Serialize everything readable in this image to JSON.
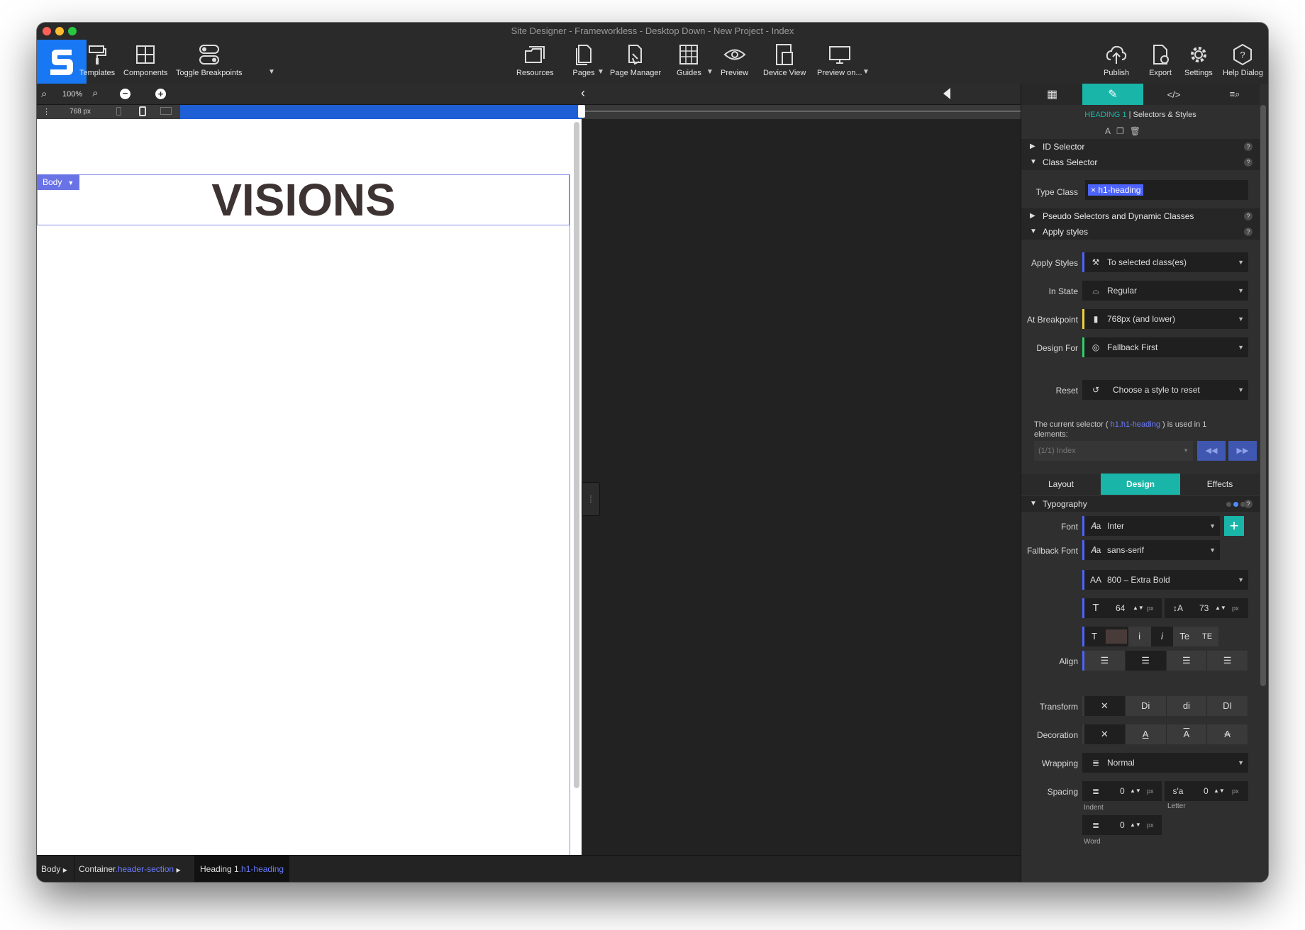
{
  "window": {
    "title": "Site Designer - Frameworkless - Desktop Down - New Project - Index"
  },
  "colors": {
    "accent_blue": "#1877f2",
    "teal": "#19b5a8",
    "selector_blue": "#6b7cff",
    "heading_text": "#3e3333",
    "swatch": "#4a3b3b"
  },
  "toolbar": {
    "left": [
      {
        "label": "Templates",
        "icon": "paint-roller-icon"
      },
      {
        "label": "Components",
        "icon": "components-grid-icon"
      },
      {
        "label": "Toggle Breakpoints",
        "icon": "toggle-icon"
      }
    ],
    "center": [
      {
        "label": "Resources",
        "icon": "folders-icon"
      },
      {
        "label": "Pages",
        "icon": "pages-icon"
      },
      {
        "label": "Page Manager",
        "icon": "page-manager-icon"
      },
      {
        "label": "Guides",
        "icon": "guides-grid-icon"
      },
      {
        "label": "Preview",
        "icon": "eye-icon"
      },
      {
        "label": "Device View",
        "icon": "devices-icon"
      },
      {
        "label": "Preview on...",
        "icon": "monitor-icon"
      }
    ],
    "right": [
      {
        "label": "Publish",
        "icon": "cloud-upload-icon"
      },
      {
        "label": "Export",
        "icon": "export-icon"
      },
      {
        "label": "Settings",
        "icon": "gear-icon"
      },
      {
        "label": "Help Dialog",
        "icon": "help-hexagon-icon"
      }
    ]
  },
  "zoom": {
    "level": "100%",
    "breakpoint": "768 px"
  },
  "canvas": {
    "body_tag": "Body",
    "heading": "VISIONS"
  },
  "statusbar": {
    "body": "Body",
    "container": "Container",
    "container_class": ".header-section",
    "heading": "Heading 1",
    "heading_class": ".h1-heading"
  },
  "panel": {
    "header_prefix": "HEADING 1",
    "header_suffix": "| Selectors & Styles",
    "id_selector": "ID Selector",
    "class_selector": "Class Selector",
    "type_class_label": "Type Class",
    "type_class_value": "h1-heading",
    "pseudo": "Pseudo Selectors and Dynamic Classes",
    "apply_styles_section": "Apply styles",
    "apply_styles_label": "Apply Styles",
    "apply_styles_value": "To selected class(es)",
    "in_state_label": "In State",
    "in_state_value": "Regular",
    "breakpoint_label": "At Breakpoint",
    "breakpoint_value": "768px (and lower)",
    "design_for_label": "Design For",
    "design_for_value": "Fallback First",
    "reset_label": "Reset",
    "reset_value": "Choose a style to reset",
    "info_prefix": "The current selector (",
    "info_selector": "h1.h1-heading",
    "info_mid": ") is used in",
    "info_count": "1",
    "info_suffix": "elements:",
    "page_select": "(1/1) Index",
    "tabs": {
      "layout": "Layout",
      "design": "Design",
      "effects": "Effects"
    },
    "typography": "Typography",
    "font_label": "Font",
    "font_value": "Inter",
    "fallback_label": "Fallback Font",
    "fallback_value": "sans-serif",
    "weight_value": "800 – Extra Bold",
    "size_value": "64",
    "size_unit": "px",
    "line_height_value": "73",
    "line_height_unit": "px",
    "style_buttons": [
      "i",
      "i",
      "Te",
      "TE"
    ],
    "align_label": "Align",
    "transform_label": "Transform",
    "transform_buttons": [
      "Di",
      "di",
      "DI"
    ],
    "decoration_label": "Decoration",
    "decoration_buttons": [
      "A",
      "A",
      "A"
    ],
    "wrapping_label": "Wrapping",
    "wrapping_value": "Normal",
    "spacing_label": "Spacing",
    "indent_value": "0",
    "indent_unit": "px",
    "indent_label": "Indent",
    "letter_value": "0",
    "letter_unit": "px",
    "letter_label": "Letter",
    "word_value": "0",
    "word_unit": "px",
    "word_label": "Word"
  }
}
